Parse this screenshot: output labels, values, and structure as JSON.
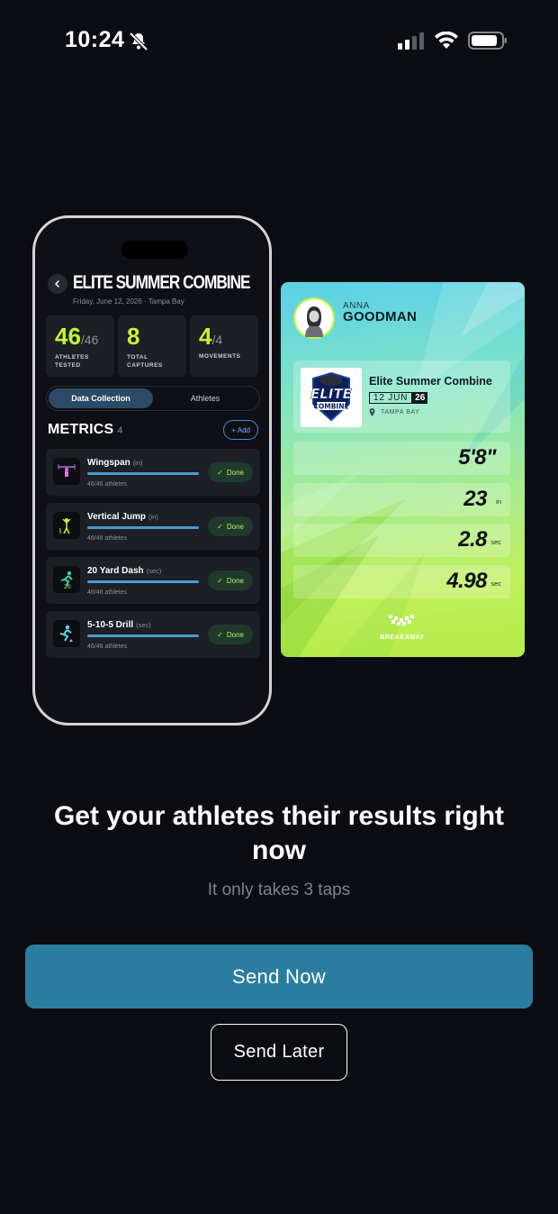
{
  "status_bar": {
    "time": "10:24"
  },
  "phone_mock": {
    "title": "ELITE SUMMER COMBINE",
    "subtitle": "Friday, June 12, 2026  ·  Tampa Bay",
    "stats": [
      {
        "value": "46",
        "suffix": "/46",
        "label_line1": "ATHLETES",
        "label_line2": "TESTED"
      },
      {
        "value": "8",
        "suffix": "",
        "label_line1": "TOTAL",
        "label_line2": "CAPTURES"
      },
      {
        "value": "4",
        "suffix": "/4",
        "label_line1": "MOVEMENTS",
        "label_line2": ""
      }
    ],
    "tabs": [
      "Data Collection",
      "Athletes"
    ],
    "metrics_title": "METRICS",
    "metrics_count": "4",
    "add_label": "+ Add",
    "metrics": [
      {
        "name": "Wingspan",
        "unit": "(in)",
        "athletes": "46/46  athletes",
        "status": "Done",
        "progress": 1.0
      },
      {
        "name": "Vertical Jump",
        "unit": "(in)",
        "athletes": "46/46 athletes",
        "status": "Done",
        "progress": 1.0
      },
      {
        "name": "20 Yard Dash",
        "unit": "(sec)",
        "athletes": "46/46  athletes",
        "status": "Done",
        "progress": 1.0
      },
      {
        "name": "5-10-5 Drill",
        "unit": "(sec)",
        "athletes": "46/46  athletes",
        "status": "Done",
        "progress": 1.0
      }
    ]
  },
  "result_card": {
    "first_name": "ANNA",
    "last_name": "GOODMAN",
    "event_name": "Elite Summer Combine",
    "event_date": "12 JUN",
    "event_year": "26",
    "location": "TAMPA BAY",
    "logo_text_top": "ELITE",
    "logo_text_bottom": "COMBINE",
    "results": [
      {
        "value": "5'8\"",
        "unit": ""
      },
      {
        "value": "23",
        "unit": "in"
      },
      {
        "value": "2.8",
        "unit": "sec"
      },
      {
        "value": "4.98",
        "unit": "sec"
      }
    ],
    "brand": "BREAKAWAY"
  },
  "headline": "Get your athletes their results right now",
  "subline": "It only takes 3 taps",
  "buttons": {
    "send_now": "Send Now",
    "send_later": "Send Later"
  },
  "colors": {
    "accent_lime": "#c6f432",
    "primary_button": "#2a7da0",
    "background": "#0b0d12"
  }
}
